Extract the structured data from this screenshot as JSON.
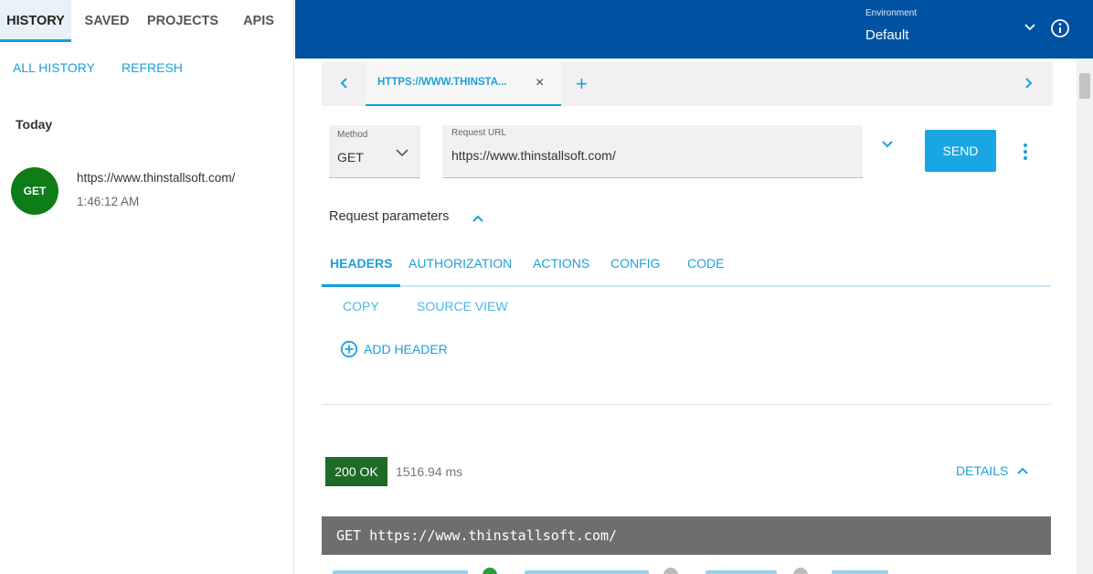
{
  "left": {
    "tabs": [
      {
        "label": "HISTORY",
        "active": true
      },
      {
        "label": "SAVED",
        "active": false
      },
      {
        "label": "PROJECTS",
        "active": false
      },
      {
        "label": "APIS",
        "active": false
      }
    ],
    "actions": {
      "all_history": "ALL HISTORY",
      "refresh": "REFRESH"
    },
    "group_title": "Today",
    "items": [
      {
        "method": "GET",
        "url": "https://www.thinstallsoft.com/",
        "time": "1:46:12 AM",
        "badge_color": "#0e7d17"
      }
    ]
  },
  "topbar": {
    "env_label": "Environment",
    "env_value": "Default",
    "color": "#0052a3"
  },
  "request_tabs": {
    "active_tab_label": "HTTPS://WWW.THINSTA...",
    "close_glyph": "×",
    "add_glyph": "+"
  },
  "request": {
    "method_label": "Method",
    "method_value": "GET",
    "url_label": "Request URL",
    "url_value": "https://www.thinstallsoft.com/",
    "send_label": "SEND"
  },
  "params": {
    "title": "Request parameters",
    "tabs": [
      "HEADERS",
      "AUTHORIZATION",
      "ACTIONS",
      "CONFIG",
      "CODE"
    ],
    "active_tab": "HEADERS",
    "copy_label": "COPY",
    "source_view_label": "SOURCE VIEW",
    "add_header_label": "ADD HEADER"
  },
  "response": {
    "status": "200 OK",
    "status_color": "#1e6b26",
    "time": "1516.94 ms",
    "details_label": "DETAILS",
    "request_line": "GET https://www.thinstallsoft.com/"
  }
}
